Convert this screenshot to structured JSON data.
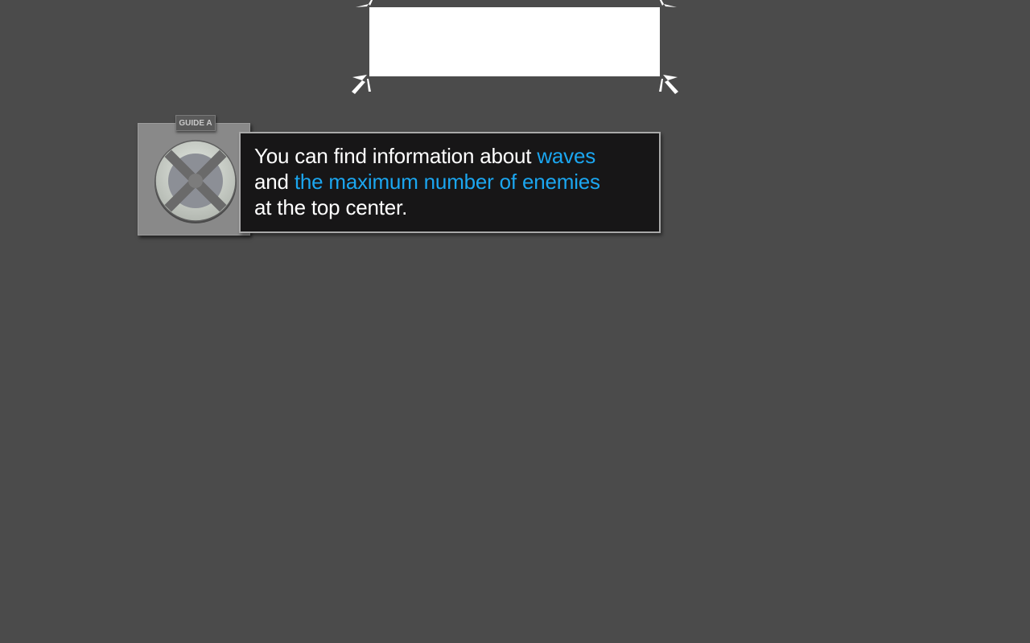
{
  "highlight": {
    "fill_color": "#ffffff",
    "marker_color": "#ffffff"
  },
  "guide": {
    "tag_label": "GUIDE A",
    "avatar_icon": "crossed-circle-icon"
  },
  "message": {
    "line1_text": "You can find information about ",
    "line1_highlight": "waves",
    "line2_text": "and ",
    "line2_highlight": "the maximum number of enemies",
    "line3_text": "at the top center.",
    "text_color": "#ffffff",
    "highlight_color": "#1ba6f0",
    "box_color": "#171617"
  },
  "background_color": "#4b4b4b"
}
